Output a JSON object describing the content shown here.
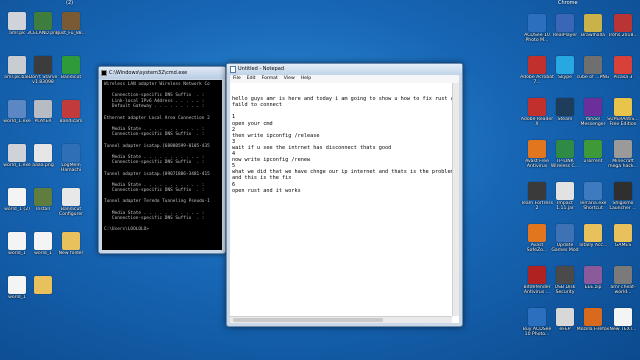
{
  "desktop": {
    "top_badge": "(2)",
    "chrome_label": "Chrome",
    "left_icons": [
      {
        "label": "amr.pk",
        "color": "#d0d4da"
      },
      {
        "label": "3CELAND.png",
        "color": "#3f7d3f"
      },
      {
        "label": "Rust_Fu_88...",
        "color": "#7a5a35"
      },
      {
        "label": "amr.pk.bak",
        "color": "#c9ccd1"
      },
      {
        "label": "Don't Starve v1.83098",
        "color": "#3c3c3c"
      },
      {
        "label": "Bandicut",
        "color": "#2f9a39"
      },
      {
        "label": "world_1.exe",
        "color": "#5b88c4"
      },
      {
        "label": "PLAYER",
        "color": "#b7bcc4"
      },
      {
        "label": "Bandicam",
        "color": "#c23b3b"
      },
      {
        "label": "world_1.exe",
        "color": "#cfd3d8"
      },
      {
        "label": "aaaa.png",
        "color": "#e6e6e6"
      },
      {
        "label": "LogMeIn Hamachi",
        "color": "#2f6fb5"
      },
      {
        "label": "world_1 (2)",
        "color": "#f4f4f4"
      },
      {
        "label": "Install",
        "color": "#5e7d3e"
      },
      {
        "label": "Bandicut Configurer",
        "color": "#e8e8e8"
      },
      {
        "label": "world_1",
        "color": "#f4f4f4"
      },
      {
        "label": "world_1",
        "color": "#f4f4f4"
      },
      {
        "label": "New folder",
        "color": "#e9c15c"
      },
      {
        "label": "world_1",
        "color": "#f4f4f4"
      },
      {
        "label": "",
        "color": "#e9c15c"
      }
    ],
    "right_icons": [
      {
        "label": "ACDSee 10 Photo M...",
        "color": "#2b6fbf"
      },
      {
        "label": "RealPlayer",
        "color": "#3a66b8"
      },
      {
        "label": "Brawlhalla",
        "color": "#c9b24a"
      },
      {
        "label": "Trofis.2018...",
        "color": "#b93535"
      },
      {
        "label": "Adobe Acrobat 7...",
        "color": "#c2302e"
      },
      {
        "label": "Skype",
        "color": "#27a8e0"
      },
      {
        "label": "cube of ...PNG",
        "color": "#6f6f6f"
      },
      {
        "label": "Picasa 3",
        "color": "#d8413a"
      },
      {
        "label": "Adobe Reader X",
        "color": "#c2302e"
      },
      {
        "label": "Steam",
        "color": "#1d3d5a"
      },
      {
        "label": "Yahoo! Messenger",
        "color": "#6a2f9a"
      },
      {
        "label": "SUPERAntiS... Free Edition",
        "color": "#e8c54a"
      },
      {
        "label": "Avast Free Antivirus",
        "color": "#e2761e"
      },
      {
        "label": "TP-LINK Wireless C...",
        "color": "#2f8a45"
      },
      {
        "label": "uTorrent",
        "color": "#3e9a38"
      },
      {
        "label": "Minecraft mega hack...",
        "color": "#9a9a9a"
      },
      {
        "label": "Team Fortress 2",
        "color": "#3a3a3a"
      },
      {
        "label": "Impact 1.11.jar",
        "color": "#e2e2e2"
      },
      {
        "label": "Terraria.exe Shortcut",
        "color": "#3d7ac0"
      },
      {
        "label": "Shigismo Launcher ...",
        "color": "#2f2f2f"
      },
      {
        "label": "Avast SafeZo...",
        "color": "#e2761e"
      },
      {
        "label": "Update Games Mod",
        "color": "#3e72b5"
      },
      {
        "label": "Totally Acc...",
        "color": "#e9c15c"
      },
      {
        "label": "GAMES",
        "color": "#e9c15c"
      },
      {
        "label": "Bitdefender Antivirus ...",
        "color": "#b02222"
      },
      {
        "label": "USB Disk Security",
        "color": "#4a4a4a"
      },
      {
        "label": "EEE.zip",
        "color": "#8a5a9a"
      },
      {
        "label": "amr cheat-world...",
        "color": "#7a7a7a"
      },
      {
        "label": "Buy ACDSee 10 Photo...",
        "color": "#2b6fbf"
      },
      {
        "label": "eFEP",
        "color": "#d8d8d8"
      },
      {
        "label": "Mozilla Firefox",
        "color": "#d86a1e"
      },
      {
        "label": "New TEXT...",
        "color": "#f4f4f4"
      }
    ]
  },
  "cmd": {
    "title": "C:\\Windows\\system32\\cmd.exe",
    "text": "Wireless LAN adapter Wireless Network Co\n\n   Connection-specific DNS Suffix  . :\n   Link-local IPv6 Address . . . . . :\n   Default Gateway . . . . . . . . . :\n\nEthernet adapter Local Area Connection 2\n\n   Media State . . . . . . . . . . . :\n   Connection-specific DNS Suffix  . :\n\nTunnel adapter isatap.{68880599-0105-435\n\n   Media State . . . . . . . . . . . :\n   Connection-specific DNS Suffix  . :\n\nTunnel adapter isatap.{09071806-3481-415\n\n   Media State . . . . . . . . . . . :\n   Connection-specific DNS Suffix  . :\n\nTunnel adapter Teredo Tunneling Pseudo-I\n\n   Media State . . . . . . . . . . . :\n   Connection-specific DNS Suffix  . :\n\nC:\\Users\\LOOLOLO>"
  },
  "notepad": {
    "title": "Untitled - Notepad",
    "menu": [
      "File",
      "Edit",
      "Format",
      "View",
      "Help"
    ],
    "text": "hello guys amr is here and today i am going to show u how to fix rust alpi\nfaild to connect\n\n1\nopen your cmd\n2\nthen write ipconfig /release\n3\nwait if u see the intrnet has disconnect thats good\n4\nnow write ipconfig /renew\n5\nwhat we did that we have chnge our ip internet and thats is the problem\nand this is the fix\n6\nopen rust and it works"
  }
}
